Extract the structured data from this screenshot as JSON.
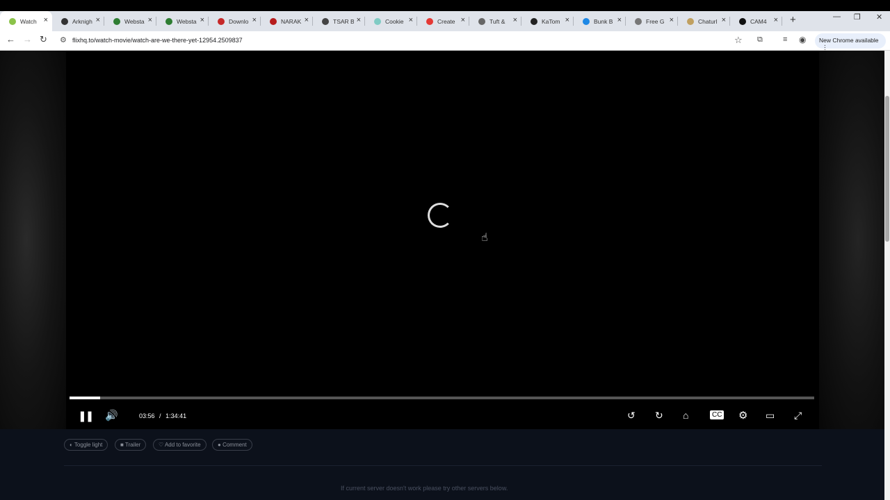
{
  "browser": {
    "tabs": [
      {
        "title": "Watch",
        "color": "#8bc34a"
      },
      {
        "title": "Arknigh",
        "color": "#333333"
      },
      {
        "title": "Websta",
        "color": "#2e7d32"
      },
      {
        "title": "Websta",
        "color": "#2e7d32"
      },
      {
        "title": "Downlo",
        "color": "#c62828"
      },
      {
        "title": "NARAK",
        "color": "#b71c1c"
      },
      {
        "title": "TSAR B",
        "color": "#444444"
      },
      {
        "title": "Cookie",
        "color": "#80cbc4"
      },
      {
        "title": "Create",
        "color": "#e53935"
      },
      {
        "title": "Tuft &",
        "color": "#666666"
      },
      {
        "title": "KaTom",
        "color": "#222222"
      },
      {
        "title": "Bunk B",
        "color": "#1e88e5"
      },
      {
        "title": "Free G",
        "color": "#777777"
      },
      {
        "title": "Chaturl",
        "color": "#c0a060"
      },
      {
        "title": "CAM4",
        "color": "#111111"
      }
    ],
    "new_tab": "+",
    "controls": {
      "minimize": "—",
      "restore": "❐",
      "close": "✕"
    },
    "url": "flixhq.to/watch-movie/watch-are-we-there-yet-12954.2509837",
    "update_label": "New Chrome available",
    "menu_icon": "⋮"
  },
  "player": {
    "current_time": "03:56",
    "separator": "/",
    "duration": "1:34:41",
    "progress_fraction": 0.0415,
    "state": "loading"
  },
  "actions": [
    {
      "icon": "◐",
      "label": "Toggle light"
    },
    {
      "icon": "■",
      "label": "Trailer"
    },
    {
      "icon": "♡",
      "label": "Add to favorite"
    },
    {
      "icon": "●",
      "label": "Comment"
    }
  ],
  "hint": "If current server doesn't work please try other servers below."
}
